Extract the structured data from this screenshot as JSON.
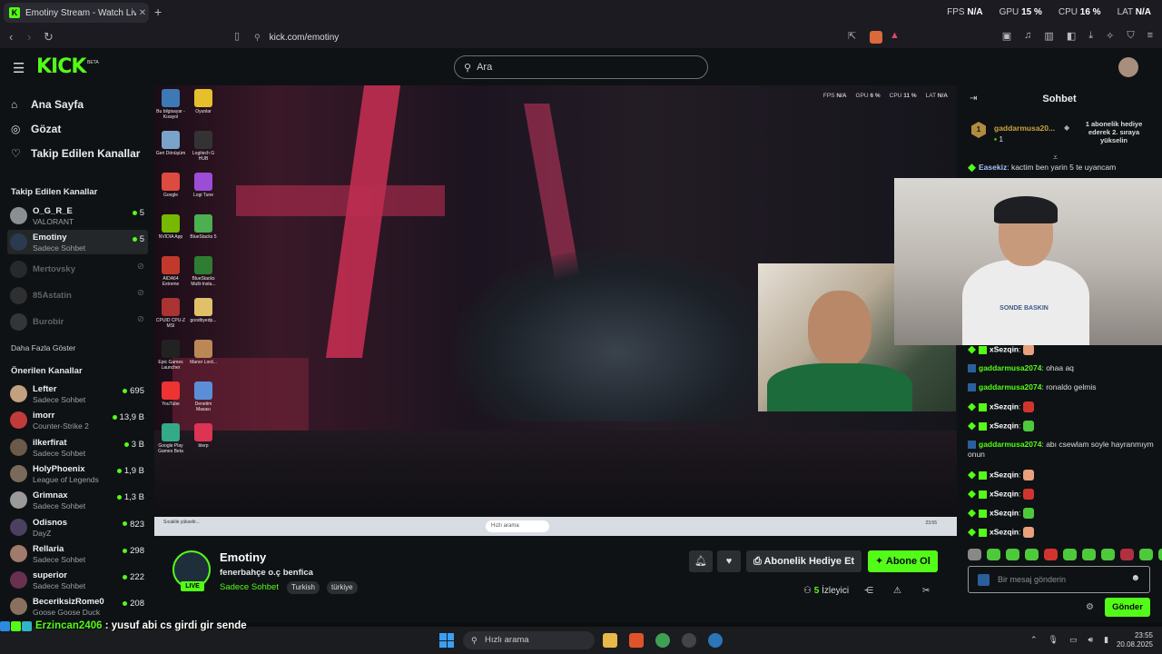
{
  "browser": {
    "tab_title": "Emotiny Stream - Watch Live",
    "tab_favicon": "K",
    "url": "kick.com/emotiny",
    "perf": [
      {
        "label": "FPS",
        "value": "N/A"
      },
      {
        "label": "GPU",
        "value": "15 %"
      },
      {
        "label": "CPU",
        "value": "16 %"
      },
      {
        "label": "LAT",
        "value": "N/A"
      }
    ]
  },
  "header": {
    "logo": "KICK",
    "beta": "BETA",
    "search_placeholder": "Ara"
  },
  "sidebar": {
    "nav": [
      {
        "label": "Ana Sayfa",
        "icon": "home-icon"
      },
      {
        "label": "Gözat",
        "icon": "compass-icon"
      },
      {
        "label": "Takip Edilen Kanallar",
        "icon": "heart-icon"
      }
    ],
    "followed_title": "Takip Edilen Kanallar",
    "followed": [
      {
        "name": "O_G_R_E",
        "sub": "VALORANT",
        "viewers": "5",
        "live": true
      },
      {
        "name": "Emotiny",
        "sub": "Sadece Sohbet",
        "viewers": "5",
        "live": true
      },
      {
        "name": "Mertovsky",
        "sub": "",
        "viewers": "",
        "live": false
      },
      {
        "name": "85Astatin",
        "sub": "",
        "viewers": "",
        "live": false
      },
      {
        "name": "Burobir",
        "sub": "",
        "viewers": "",
        "live": false
      }
    ],
    "show_more": "Daha Fazla Göster",
    "recommended_title": "Önerilen Kanallar",
    "recommended": [
      {
        "name": "Lefter",
        "sub": "Sadece Sohbet",
        "viewers": "695"
      },
      {
        "name": "imorr",
        "sub": "Counter-Strike 2",
        "viewers": "13,9 B"
      },
      {
        "name": "ilkerfirat",
        "sub": "Sadece Sohbet",
        "viewers": "3 B"
      },
      {
        "name": "HolyPhoenix",
        "sub": "League of Legends",
        "viewers": "1,9 B"
      },
      {
        "name": "Grimnax",
        "sub": "Sadece Sohbet",
        "viewers": "1,3 B"
      },
      {
        "name": "Odisnos",
        "sub": "DayZ",
        "viewers": "823"
      },
      {
        "name": "Rellaria",
        "sub": "Sadece Sohbet",
        "viewers": "298"
      },
      {
        "name": "superior",
        "sub": "Sadece Sohbet",
        "viewers": "222"
      },
      {
        "name": "BeceriksizRome0",
        "sub": "Goose Goose Duck",
        "viewers": "208"
      }
    ]
  },
  "stream": {
    "inner_perf": [
      {
        "label": "FPS",
        "value": "N/A"
      },
      {
        "label": "GPU",
        "value": "6 %"
      },
      {
        "label": "CPU",
        "value": "11 %"
      },
      {
        "label": "LAT",
        "value": "N/A"
      }
    ],
    "desktop_icons": [
      "Bu bilgisayar - Kısayol",
      "Oyunlar",
      "Geri Dönüşüm",
      "Logitech G HUB",
      "Google",
      "Logi Tune",
      "NVIDIA App",
      "BlueStacks 5",
      "AIDA64 Extreme",
      "BlueStacks Multi-Insta...",
      "CPUID CPU-Z MSI",
      "goodbyedp...",
      "Epic Games Launcher",
      "Manor Lord...",
      "YouTube",
      "Denetim Masası",
      "Google Play Games Beta",
      "blerp"
    ],
    "inner_search": "Hızlı arama",
    "inner_weather": "Sıcaklık yükselir...",
    "inner_clock": "23:55",
    "facecam_logo": "SONDE BASKIN"
  },
  "channel": {
    "name": "Emotiny",
    "live": "LIVE",
    "title": "fenerbahçe o.ç benfica",
    "category": "Sadece Sohbet",
    "tags": [
      "Turkish",
      "türkiye"
    ],
    "gift_label": "Abonelik Hediye Et",
    "subscribe_label": "Abone Ol",
    "viewer_count": "5",
    "viewer_label": "İzleyici"
  },
  "chat": {
    "title": "Sohbet",
    "pinned": {
      "rank": "1",
      "user": "gaddarmusa20...",
      "count": "1",
      "message": "1 abonelik hediye ederek 2. sıraya yükselin"
    },
    "messages": [
      {
        "user": "Easekiz",
        "text": "kactim ben yarin 5 te uyancam",
        "color": "#a6c0ff",
        "badge": "#53fc18",
        "emote": ""
      },
      {
        "user": "xSezqin",
        "text": "",
        "color": "#ffffff",
        "badge": "#53fc18",
        "emote": "#e9a07c"
      },
      {
        "user": "gaddarmusa2074",
        "text": "ohaa aq",
        "color": "#53fc18",
        "badge": "#2b5f9b",
        "emote": ""
      },
      {
        "user": "gaddarmusa2074",
        "text": "ronaldo gelmis",
        "color": "#53fc18",
        "badge": "#2b5f9b",
        "emote": ""
      },
      {
        "user": "xSezqin",
        "text": "",
        "color": "#ffffff",
        "badge": "#53fc18",
        "emote": "#d1342f"
      },
      {
        "user": "xSezqin",
        "text": "",
        "color": "#ffffff",
        "badge": "#53fc18",
        "emote": "#4ec93b"
      },
      {
        "user": "gaddarmusa2074",
        "text": "abı csewlam soyle hayranmıym onun",
        "color": "#53fc18",
        "badge": "#2b5f9b",
        "emote": ""
      },
      {
        "user": "xSezqin",
        "text": "",
        "color": "#ffffff",
        "badge": "#53fc18",
        "emote": "#e9a07c"
      },
      {
        "user": "xSezqin",
        "text": "",
        "color": "#ffffff",
        "badge": "#53fc18",
        "emote": "#d1342f"
      },
      {
        "user": "xSezqin",
        "text": "",
        "color": "#ffffff",
        "badge": "#53fc18",
        "emote": "#4ec93b"
      },
      {
        "user": "xSezqin",
        "text": "",
        "color": "#ffffff",
        "badge": "#53fc18",
        "emote": "#e9a07c"
      }
    ],
    "input_placeholder": "Bir mesaj gönderin",
    "send_label": "Gönder"
  },
  "overlay": {
    "user": "Erzincan2406",
    "text": "yusuf abi cs girdi gir sende"
  },
  "os": {
    "search": "Hızlı arama",
    "time": "23:55",
    "date": "20.08.2025"
  },
  "colors": {
    "accent": "#53fc18",
    "bg": "#0e1214"
  }
}
